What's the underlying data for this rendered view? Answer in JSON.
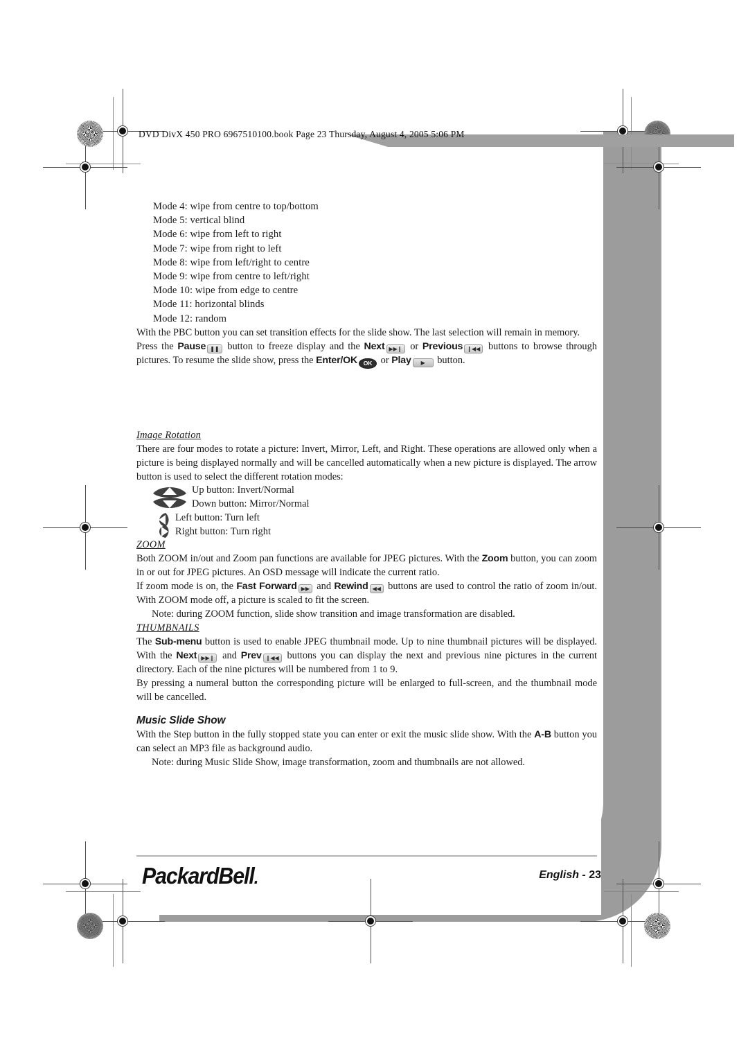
{
  "header": {
    "file_info": "DVD DivX 450 PRO 6967510100.book  Page 23  Thursday, August 4, 2005  5:06 PM"
  },
  "content": {
    "mode_list": [
      "Mode 4: wipe from centre to top/bottom",
      "Mode 5: vertical blind",
      "Mode 6: wipe from left to right",
      "Mode 7: wipe from right to left",
      "Mode 8: wipe from left/right to centre",
      "Mode 9: wipe from centre to left/right",
      "Mode 10: wipe from edge to centre",
      "Mode 11: horizontal blinds",
      "Mode 12: random"
    ],
    "pbc_paragraph": "With the PBC button you can set transition effects for the slide show. The last selection will remain in memory.",
    "pause_para": {
      "p1": "Press the ",
      "kw_pause": "Pause",
      "p2": " button to freeze display and the ",
      "kw_next": "Next",
      "p3": " or ",
      "kw_previous": "Previous",
      "p4": " buttons to browse through pictures. To resume the slide show, press the ",
      "kw_enter": "Enter/OK",
      "p5": " or ",
      "kw_play": "Play",
      "p6": " button."
    },
    "image_rotation": {
      "heading": "Image Rotation",
      "body": "There are four modes to rotate a picture: Invert, Mirror, Left, and Right. These operations are allowed only when a picture is being displayed normally and will be cancelled automatically when a new picture is displayed. The arrow button is used to select the different rotation modes:",
      "rows": [
        "Up button: Invert/Normal",
        "Down button: Mirror/Normal",
        "Left button: Turn left",
        "Right button: Turn right"
      ]
    },
    "zoom_section": {
      "heading": "ZOOM",
      "p1_a": "Both ZOOM in/out and Zoom pan functions are available for JPEG pictures. With the ",
      "p1_kw": "Zoom",
      "p1_b": " button, you can zoom in or out for JPEG pictures. An OSD message will indicate the current ratio.",
      "p2_a": "If zoom mode is on, the ",
      "p2_kw1": "Fast Forward",
      "p2_b": " and ",
      "p2_kw2": "Rewind",
      "p2_c": " buttons are used to control the ratio of zoom in/out. With ZOOM mode off, a picture is scaled to fit the screen.",
      "note": "Note: during ZOOM function, slide show transition and image transformation are disabled."
    },
    "thumbnails_section": {
      "heading": "THUMBNAILS",
      "p1_a": "The ",
      "p1_kw": "Sub-menu",
      "p1_b": " button is used to enable JPEG thumbnail mode. Up to nine thumbnail pictures will be displayed. With the ",
      "p1_kw2": "Next",
      "p1_c": " and ",
      "p1_kw3": "Prev",
      "p1_d": " buttons you can display the next and previous nine pictures in the current directory. Each of the nine pictures will be numbered from 1 to 9.",
      "p2": "By pressing a numeral button the corresponding picture will be enlarged to full-screen, and the thumbnail mode will be cancelled."
    },
    "music_slide_show": {
      "heading": "Music Slide Show",
      "p1_a": "With the Step button in the fully stopped state you can enter or exit the music slide show. With the ",
      "p1_kw": "A-B",
      "p1_b": " button you can select an MP3 file as background audio.",
      "note": "Note: during Music Slide Show, image transformation, zoom and thumbnails are not allowed."
    }
  },
  "keys": {
    "pause": "❚❚",
    "next": "▶▶❙",
    "previous": "❙◀◀",
    "ok": "OK",
    "play": "▶",
    "fast_forward": "▶▶",
    "rewind": "◀◀",
    "prev": "❙◀◀",
    "next2": "▶▶❙"
  },
  "footer": {
    "logo_main": "Packard",
    "logo_second": "Bell",
    "logo_dot": ".",
    "language": "English",
    "separator": " - ",
    "page_number": "23"
  },
  "colors": {
    "shadow_gray": "#9c9c9c",
    "header_wedge": "#a0a0a0",
    "rule": "#b4b4b4",
    "text": "#1a1a1a"
  }
}
